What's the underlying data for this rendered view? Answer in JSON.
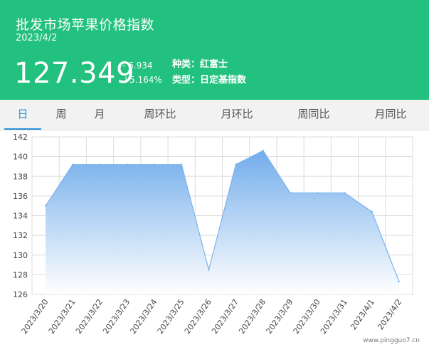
{
  "header": {
    "title": "批发市场苹果价格指数",
    "date": "2023/4/2",
    "value": "127.349",
    "change": "- 6.934",
    "change_pct": "↓5.164%",
    "variety_label": "种类：",
    "variety_value": "红富士",
    "type_label": "类型：",
    "type_value": "日定基指数"
  },
  "tabs": [
    "日",
    "周",
    "月",
    "周环比",
    "月环比",
    "周同比",
    "月同比"
  ],
  "active_tab": 0,
  "watermark": "www.pingguo7.cn",
  "colors": {
    "header_bg": "#23c17f",
    "accent": "#2a8fd7",
    "area": "#7bb3ec"
  },
  "chart_data": {
    "type": "area",
    "title": "",
    "xlabel": "",
    "ylabel": "",
    "x": [
      "2023/3/20",
      "2023/3/21",
      "2023/3/22",
      "2023/3/23",
      "2023/3/24",
      "2023/3/25",
      "2023/3/26",
      "2023/3/27",
      "2023/3/28",
      "2023/3/29",
      "2023/3/30",
      "2023/3/31",
      "2023/4/1",
      "2023/4/2"
    ],
    "values": [
      135.0,
      139.2,
      139.2,
      139.2,
      139.2,
      139.2,
      128.5,
      139.2,
      140.6,
      136.3,
      136.3,
      136.3,
      134.4,
      127.3
    ],
    "ylim": [
      126,
      142
    ],
    "yticks": [
      126,
      128,
      130,
      132,
      134,
      136,
      138,
      140,
      142
    ],
    "grid": true
  }
}
